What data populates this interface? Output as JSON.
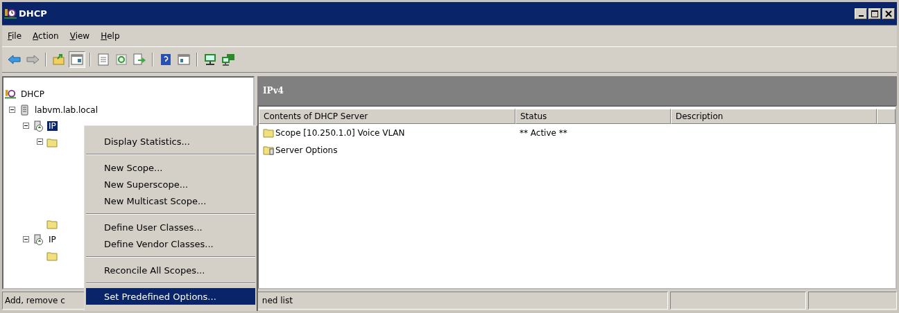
{
  "window": {
    "title": "DHCP"
  },
  "menu_bar": [
    {
      "label": "File"
    },
    {
      "label": "Action"
    },
    {
      "label": "View"
    },
    {
      "label": "Help"
    }
  ],
  "toolbar": [
    {
      "kind": "back"
    },
    {
      "kind": "forward"
    },
    {
      "kind": "sep"
    },
    {
      "kind": "up"
    },
    {
      "kind": "tree",
      "pressed": true
    },
    {
      "kind": "sep"
    },
    {
      "kind": "properties"
    },
    {
      "kind": "refresh"
    },
    {
      "kind": "export"
    },
    {
      "kind": "sep"
    },
    {
      "kind": "help"
    },
    {
      "kind": "pane"
    },
    {
      "kind": "sep"
    },
    {
      "kind": "monitor"
    },
    {
      "kind": "monitors"
    }
  ],
  "tree": [
    {
      "kind": "dhcp",
      "label": "DHCP",
      "children": [
        {
          "kind": "server",
          "label": "labvm.lab.local",
          "expanded": true,
          "children": [
            {
              "kind": "ip",
              "label": "IP",
              "selected": true,
              "expanded": true,
              "children": [
                {
                  "kind": "folder",
                  "expanded": true
                },
                {
                  "kind": "folder"
                }
              ]
            },
            {
              "kind": "ip",
              "label": "IP",
              "selected": false,
              "expanded": true,
              "children": [
                {
                  "kind": "folder"
                }
              ]
            }
          ]
        }
      ]
    }
  ],
  "context_menu": [
    {
      "label": "Display Statistics...",
      "selected": false
    },
    {
      "kind": "sep"
    },
    {
      "label": "New Scope...",
      "selected": false
    },
    {
      "label": "New Superscope...",
      "selected": false
    },
    {
      "label": "New Multicast Scope...",
      "selected": false
    },
    {
      "kind": "sep"
    },
    {
      "label": "Define User Classes...",
      "selected": false
    },
    {
      "label": "Define Vendor Classes...",
      "selected": false
    },
    {
      "kind": "sep"
    },
    {
      "label": "Reconcile All Scopes...",
      "selected": false
    },
    {
      "kind": "sep"
    },
    {
      "label": "Set Predefined Options...",
      "selected": true
    }
  ],
  "details": {
    "title": "IPv4",
    "columns": [
      "Contents of DHCP Server",
      "Status",
      "Description"
    ],
    "rows": [
      {
        "kind": "scope",
        "name": "Scope [10.250.1.0] Voice VLAN",
        "status": "** Active **"
      },
      {
        "kind": "options",
        "name": "Server Options"
      }
    ]
  },
  "status_bar": {
    "text_start": "Add, remove c",
    "text_end": "ned list"
  }
}
